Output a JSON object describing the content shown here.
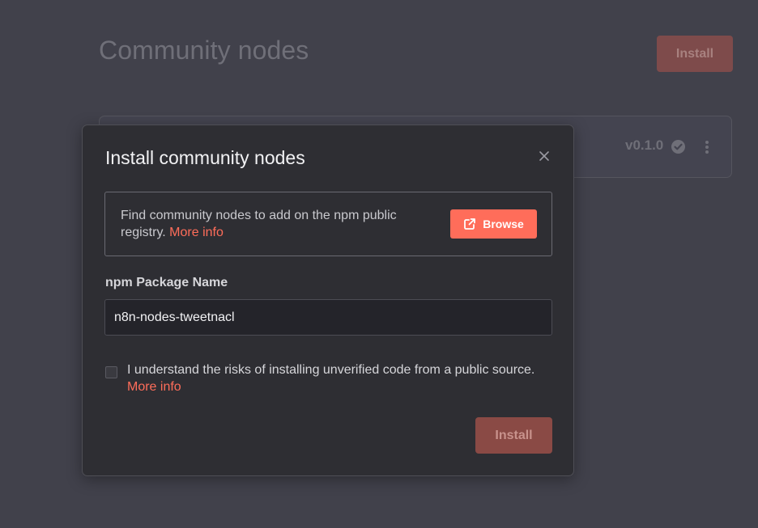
{
  "background": {
    "page_title": "Community nodes",
    "install_label": "Install",
    "package_version": "v0.1.0",
    "verified_icon": "check-circle-icon",
    "menu_icon": "more-vertical-icon"
  },
  "modal": {
    "title": "Install community nodes",
    "close_icon": "close-icon",
    "info": {
      "text": "Find community nodes to add on the npm public registry.",
      "more_info": "More info",
      "browse_label": "Browse",
      "browse_icon": "external-link-icon"
    },
    "package_field": {
      "label": "npm Package Name",
      "value": "n8n-nodes-tweetnacl"
    },
    "risk_checkbox": {
      "checked": false,
      "label": "I understand the risks of installing unverified code from a public source.",
      "more_info": "More info"
    },
    "install_label": "Install"
  },
  "colors": {
    "accent": "#ff6d5a",
    "modal_bg": "#2e2e33",
    "page_bg": "#41414b",
    "disabled_button": "#8a4a45"
  }
}
